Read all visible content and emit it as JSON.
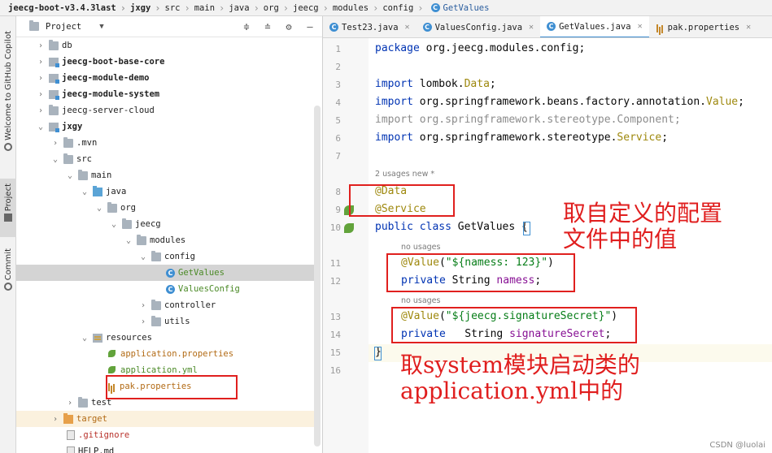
{
  "breadcrumb": {
    "items": [
      "jeecg-boot-v3.4.3last",
      "jxgy",
      "src",
      "main",
      "java",
      "org",
      "jeecg",
      "modules",
      "config"
    ],
    "file": "GetValues"
  },
  "tool_strip": {
    "copilot": "Welcome to GitHub Copilot",
    "project": "Project",
    "commit": "Commit"
  },
  "project_panel": {
    "title": "Project",
    "tree": [
      {
        "label": "db",
        "icon": "folder"
      },
      {
        "label": "jeecg-boot-base-core",
        "icon": "module"
      },
      {
        "label": "jeecg-module-demo",
        "icon": "module"
      },
      {
        "label": "jeecg-module-system",
        "icon": "module"
      },
      {
        "label": "jeecg-server-cloud",
        "icon": "folder"
      },
      {
        "label": "jxgy",
        "icon": "module"
      },
      {
        "label": ".mvn",
        "icon": "folder"
      },
      {
        "label": "src",
        "icon": "folder"
      },
      {
        "label": "main",
        "icon": "folder"
      },
      {
        "label": "java",
        "icon": "source-folder"
      },
      {
        "label": "org",
        "icon": "package"
      },
      {
        "label": "jeecg",
        "icon": "package"
      },
      {
        "label": "modules",
        "icon": "package"
      },
      {
        "label": "config",
        "icon": "package"
      },
      {
        "label": "GetValues",
        "icon": "class"
      },
      {
        "label": "ValuesConfig",
        "icon": "class"
      },
      {
        "label": "controller",
        "icon": "package"
      },
      {
        "label": "utils",
        "icon": "package"
      },
      {
        "label": "resources",
        "icon": "resources-folder"
      },
      {
        "label": "application.properties",
        "icon": "spring-leaf"
      },
      {
        "label": "application.yml",
        "icon": "spring-leaf"
      },
      {
        "label": "pak.properties",
        "icon": "properties"
      },
      {
        "label": "test",
        "icon": "folder"
      },
      {
        "label": "target",
        "icon": "excluded-folder"
      },
      {
        "label": ".gitignore",
        "icon": "file"
      },
      {
        "label": "HELP.md",
        "icon": "file"
      }
    ]
  },
  "tabs": [
    {
      "label": "Test23.java",
      "icon": "class"
    },
    {
      "label": "ValuesConfig.java",
      "icon": "class"
    },
    {
      "label": "GetValues.java",
      "icon": "class",
      "active": true
    },
    {
      "label": "pak.properties",
      "icon": "properties"
    }
  ],
  "editor": {
    "line_numbers": [
      "1",
      "2",
      "3",
      "4",
      "5",
      "6",
      "7",
      "8",
      "9",
      "10",
      "11",
      "12",
      "13",
      "14",
      "15",
      "16"
    ],
    "code": {
      "l1_kw": "package",
      "l1_rest": " org.jeecg.modules.config;",
      "l3_kw": "import",
      "l3_rest": " lombok.",
      "l3_cls": "Data",
      "l3_end": ";",
      "l4_kw": "import",
      "l4_rest": " org.springframework.beans.factory.annotation.",
      "l4_cls": "Value",
      "l4_end": ";",
      "l5_text": "import org.springframework.stereotype.Component;",
      "l6_kw": "import",
      "l6_rest": " org.springframework.stereotype.",
      "l6_cls": "Service",
      "l6_end": ";",
      "hint_usages": "2 usages  new *",
      "l8": "@Data",
      "l9": "@Service",
      "l10_kw1": "public",
      "l10_kw2": " class",
      "l10_rest": " GetValues {",
      "hint_no_usages_1": "no usages",
      "l11_an": "@Value",
      "l11_p1": "(",
      "l11_str": "\"${namess: 123}\"",
      "l11_p2": ")",
      "l12_kw": "private",
      "l12_typ": " String ",
      "l12_fld": "namess",
      "l12_end": ";",
      "hint_no_usages_2": "no usages",
      "l13_an": "@Value",
      "l13_p1": "(",
      "l13_str": "\"${jeecg.signatureSecret}\"",
      "l13_p2": ")",
      "l14_kw": "private",
      "l14_typ": "   String ",
      "l14_fld": "signatureSecret",
      "l14_end": ";",
      "l15": "}"
    }
  },
  "annotations": {
    "note1_line1": "取自定义的配置",
    "note1_line2": "文件中的值",
    "note2_line1": "取system模块启动类的",
    "note2_line2": "application.yml中的"
  },
  "watermark": "CSDN @luolai",
  "colors": {
    "annotation_red": "#e0201e",
    "keyword": "#0033b3",
    "annotation": "#9e880d",
    "string": "#067d17",
    "field": "#871094"
  }
}
